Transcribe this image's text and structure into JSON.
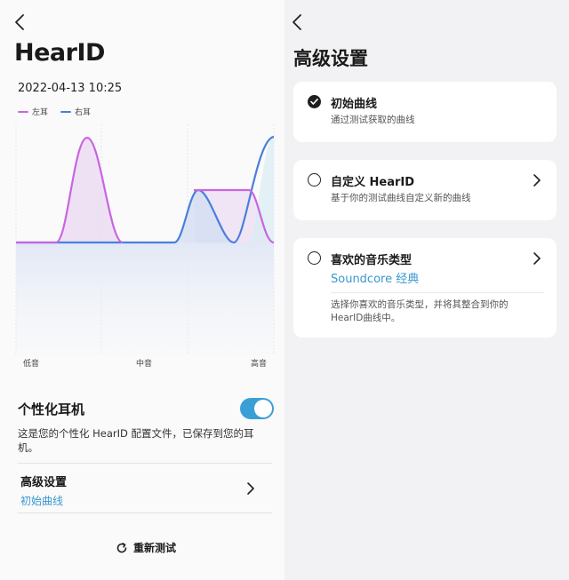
{
  "left": {
    "title": "HearID",
    "datetime": "2022-04-13 10:25",
    "legend": [
      {
        "label": "左耳",
        "color": "#c965e0"
      },
      {
        "label": "右耳",
        "color": "#4a7fd9"
      }
    ],
    "x_ticks": [
      "低音",
      "中音",
      "高音"
    ],
    "personal": {
      "title": "个性化耳机",
      "toggle_on": true,
      "description": "这是您的个性化 HearID 配置文件，已保存到您的耳机。"
    },
    "advanced": {
      "title": "高级设置",
      "value": "初始曲线"
    },
    "retest_label": "重新测试"
  },
  "right": {
    "title": "高级设置",
    "options": [
      {
        "title": "初始曲线",
        "subtitle": "通过测试获取的曲线",
        "selected": true
      },
      {
        "title": "自定义 HearID",
        "subtitle": "基于你的测试曲线自定义新的曲线",
        "selected": false
      },
      {
        "title": "喜欢的音乐类型",
        "value": "Soundcore 经典",
        "description": "选择你喜欢的音乐类型，并将其整合到你的HearID曲线中。",
        "selected": false
      }
    ]
  },
  "colors": {
    "accent": "#3a97cf",
    "left_ear": "#c965e0",
    "right_ear": "#4a7fd9"
  }
}
